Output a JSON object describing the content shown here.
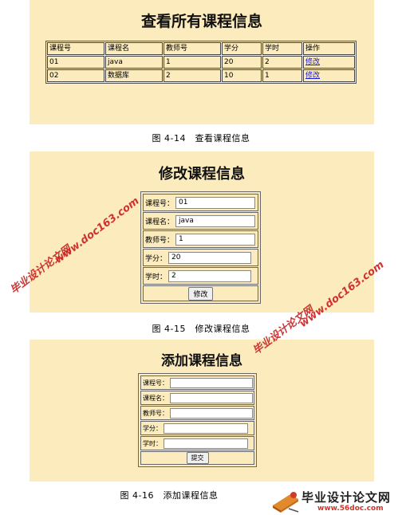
{
  "section1": {
    "title": "查看所有课程信息",
    "headers": [
      "课程号",
      "课程名",
      "教师号",
      "学分",
      "学时",
      "操作"
    ],
    "rows": [
      [
        "01",
        "java",
        "1",
        "20",
        "2",
        "修改"
      ],
      [
        "02",
        "数据库",
        "2",
        "10",
        "1",
        "修改"
      ]
    ],
    "caption": "图 4-14　查看课程信息"
  },
  "section2": {
    "title": "修改课程信息",
    "fields": [
      {
        "label": "课程号：",
        "value": "01"
      },
      {
        "label": "课程名：",
        "value": "java"
      },
      {
        "label": "教师号：",
        "value": "1"
      },
      {
        "label": "学分：",
        "value": "20"
      },
      {
        "label": "学时：",
        "value": "2"
      }
    ],
    "button": "修改",
    "caption": "图 4-15　修改课程信息"
  },
  "section3": {
    "title": "添加课程信息",
    "fields": [
      {
        "label": "课程号：",
        "value": ""
      },
      {
        "label": "课程名：",
        "value": ""
      },
      {
        "label": "教师号：",
        "value": ""
      },
      {
        "label": "学分：",
        "value": ""
      },
      {
        "label": "学时：",
        "value": ""
      }
    ],
    "button": "提交",
    "caption": "图 4-16　添加课程信息"
  },
  "watermarks": {
    "url1": "www.doc163.com",
    "site1": "毕业设计论文网",
    "url2": "www.doc163.com",
    "site2": "毕业设计论文网"
  },
  "logo": {
    "name": "毕业设计论文网",
    "url": "www.56doc.com"
  },
  "colors": {
    "panel_bg": "#fcebbd",
    "link": "#1a1acc",
    "watermark": "#c82020"
  }
}
